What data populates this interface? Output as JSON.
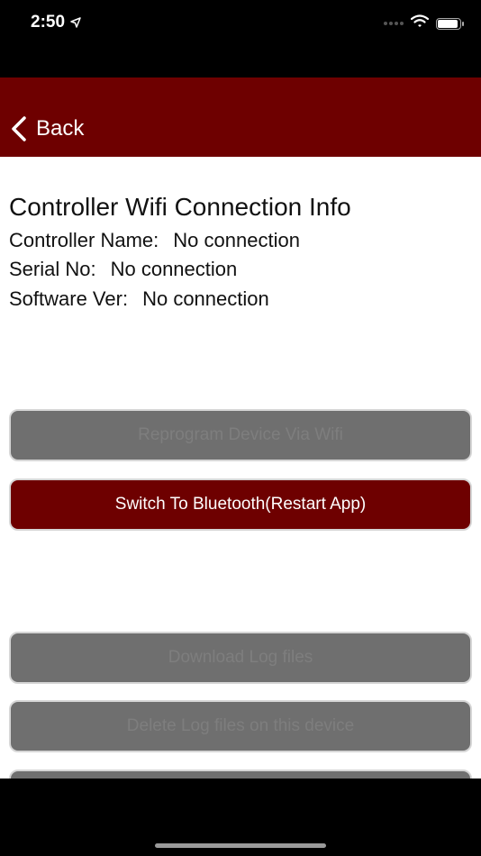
{
  "status_bar": {
    "time": "2:50",
    "icons": [
      "location-arrow-icon",
      "signal-dots-icon",
      "wifi-icon",
      "battery-icon"
    ]
  },
  "nav": {
    "back_label": "Back",
    "background": "#6e0000"
  },
  "info": {
    "title": "Controller Wifi Connection Info",
    "rows": [
      {
        "label": "Controller Name:",
        "value": "No connection"
      },
      {
        "label": "Serial No:",
        "value": "No connection"
      },
      {
        "label": "Software Ver:",
        "value": "No connection"
      }
    ]
  },
  "buttons": {
    "reprogram": "Reprogram Device Via Wifi",
    "switch_bt": "Switch To Bluetooth(Restart App)",
    "download_logs": "Download Log files",
    "delete_logs": "Delete Log files on this device"
  },
  "colors": {
    "accent": "#6e0000",
    "disabled": "#6f6f6f"
  }
}
